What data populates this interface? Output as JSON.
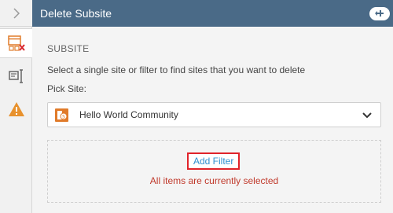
{
  "header": {
    "title": "Delete Subsite"
  },
  "section": {
    "title": "SUBSITE",
    "instructions": "Select a single site or filter to find sites that you want to delete",
    "pick_label": "Pick Site:"
  },
  "site_select": {
    "value": "Hello World Community"
  },
  "filter": {
    "add_label": "Add Filter",
    "status": "All items are currently selected"
  },
  "colors": {
    "header_bg": "#4a6a87",
    "accent_link": "#2f8fd0",
    "error_red": "#c0392b",
    "warning_orange": "#e8912d"
  },
  "icons": [
    "chevron-right-icon",
    "delete-subsite-icon",
    "properties-icon",
    "warning-icon",
    "add-icon",
    "site-icon",
    "chevron-down-icon"
  ]
}
